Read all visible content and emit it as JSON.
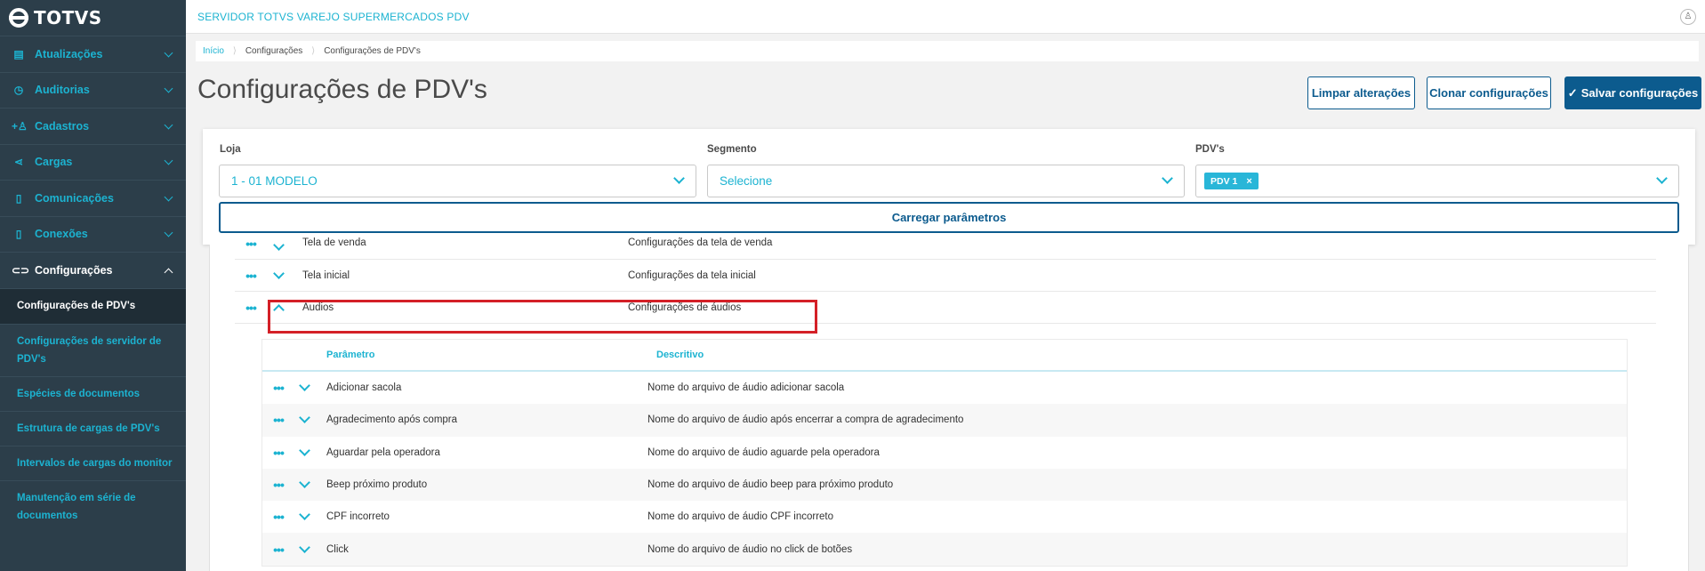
{
  "brand": {
    "logo_text": "TOTVS"
  },
  "sidebar": {
    "items": [
      {
        "label": "Atualizações",
        "icon": "server-icon"
      },
      {
        "label": "Auditorias",
        "icon": "history-icon"
      },
      {
        "label": "Cadastros",
        "icon": "add-user-icon"
      },
      {
        "label": "Cargas",
        "icon": "share-icon"
      },
      {
        "label": "Comunicações",
        "icon": "document-icon"
      },
      {
        "label": "Conexões",
        "icon": "document-icon"
      },
      {
        "label": "Configurações",
        "icon": "link-icon"
      }
    ],
    "subitems": [
      "Configurações de PDV's",
      "Configurações de servidor de PDV's",
      "Espécies de documentos",
      "Estrutura de cargas de PDV's",
      "Intervalos de cargas do monitor",
      "Manutenção em série de documentos"
    ]
  },
  "header": {
    "title": "SERVIDOR TOTVS VAREJO SUPERMERCADOS PDV"
  },
  "breadcrumb": [
    "Início",
    "Configurações",
    "Configurações de PDV's"
  ],
  "page": {
    "title": "Configurações de PDV's",
    "buttons": {
      "clear": "Limpar alterações",
      "clone": "Clonar configurações",
      "save": "Salvar configurações"
    }
  },
  "filters": {
    "loja": {
      "label": "Loja",
      "value": "1 - 01 MODELO"
    },
    "segmento": {
      "label": "Segmento",
      "value": "Selecione"
    },
    "pdvs": {
      "label": "PDV's",
      "chip": "PDV 1",
      "chip_remove": "×"
    },
    "load_button": "Carregar parâmetros"
  },
  "groups": [
    {
      "name": "Tela de venda",
      "desc": "Configurações da tela de venda",
      "expanded": false
    },
    {
      "name": "Tela inicial",
      "desc": "Configurações da tela inicial",
      "expanded": false
    },
    {
      "name": "Áudios",
      "desc": "Configurações de áudios",
      "expanded": true
    }
  ],
  "inner_table": {
    "headers": {
      "param": "Parâmetro",
      "desc": "Descritivo"
    },
    "rows": [
      {
        "param": "Adicionar sacola",
        "desc": "Nome do arquivo de áudio adicionar sacola"
      },
      {
        "param": "Agradecimento após compra",
        "desc": "Nome do arquivo de áudio após encerrar a compra de agradecimento"
      },
      {
        "param": "Aguardar pela operadora",
        "desc": "Nome do arquivo de áudio aguarde pela operadora"
      },
      {
        "param": "Beep próximo produto",
        "desc": "Nome do arquivo de áudio beep para próximo produto"
      },
      {
        "param": "CPF incorreto",
        "desc": "Nome do arquivo de áudio CPF incorreto"
      },
      {
        "param": "Click",
        "desc": "Nome do arquivo de áudio no click de botões"
      }
    ]
  },
  "colors": {
    "accent": "#1cb3d1",
    "primary": "#0c5b8e",
    "sidebar": "#2c3e4a",
    "highlight": "#d42027"
  }
}
